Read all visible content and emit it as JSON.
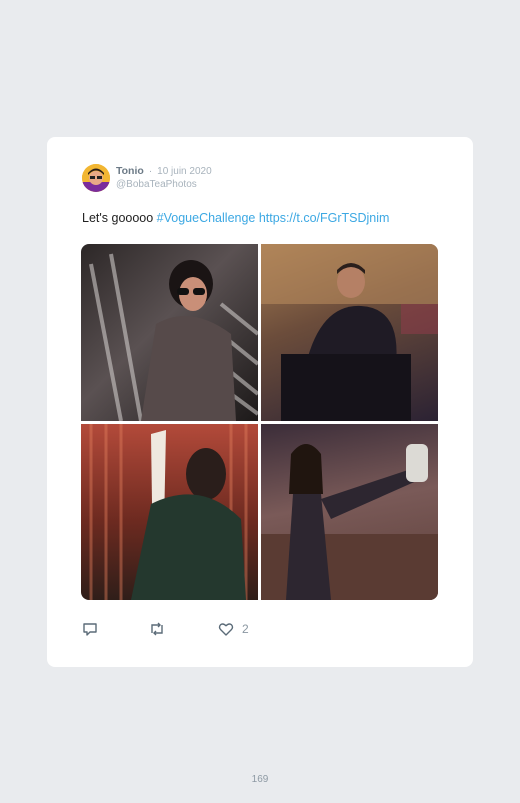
{
  "tweet": {
    "author_name": "Tonio",
    "separator": "·",
    "date": "10 juin 2020",
    "handle": "@BobaTeaPhotos",
    "text_prefix": "Let's gooooo ",
    "hashtag": "#VogueChallenge",
    "link": "https://t.co/FGrTSDjnim",
    "photos": [
      {
        "icon": "vogue-cover-photo"
      },
      {
        "icon": "vogue-cover-photo"
      },
      {
        "icon": "vogue-cover-photo"
      },
      {
        "icon": "vogue-cover-photo"
      }
    ],
    "actions": {
      "reply_icon": "reply-icon",
      "retweet_icon": "retweet-icon",
      "like_icon": "heart-icon",
      "like_count": "2"
    }
  },
  "page_number": "169",
  "colors": {
    "page_background": "#e9ebee",
    "card_background": "#ffffff",
    "link": "#3ca8e3",
    "muted_text": "#a8b3bc"
  }
}
